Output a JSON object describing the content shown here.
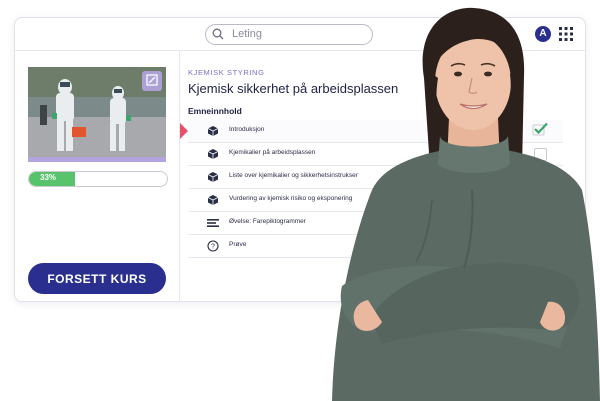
{
  "search": {
    "placeholder": "Leting"
  },
  "user": {
    "avatar_initial": "A"
  },
  "course": {
    "category": "KJEMISK STYRING",
    "title": "Kjemisk sikkerhet på arbeidsplassen",
    "progress_label": "33%",
    "progress_value": 0.33,
    "continue_label": "FORSETT KURS"
  },
  "contents": {
    "heading": "Emneinnhold",
    "lessons": [
      {
        "label": "Introduksjon",
        "icon": "cube-icon",
        "completed": true,
        "active": true
      },
      {
        "label": "Kjemikalier på arbeidsplassen",
        "icon": "cube-icon",
        "completed": false,
        "active": false
      },
      {
        "label": "Liste over kjemikalier og sikkerhetsinstrukser",
        "icon": "cube-icon",
        "completed": false,
        "active": false
      },
      {
        "label": "Vurdering av kjemisk risiko og eksponering",
        "icon": "cube-icon",
        "completed": false,
        "active": false
      },
      {
        "label": "Øvelse: Farepiktogrammer",
        "icon": "exercise-icon",
        "completed": false,
        "active": false
      },
      {
        "label": "Prøve",
        "icon": "question-icon",
        "completed": false,
        "active": false
      }
    ]
  },
  "colors": {
    "brand": "#2a2f8f",
    "accent_purple": "#7b6fc9",
    "progress_green": "#57c46b",
    "active_marker": "#e8506a"
  }
}
